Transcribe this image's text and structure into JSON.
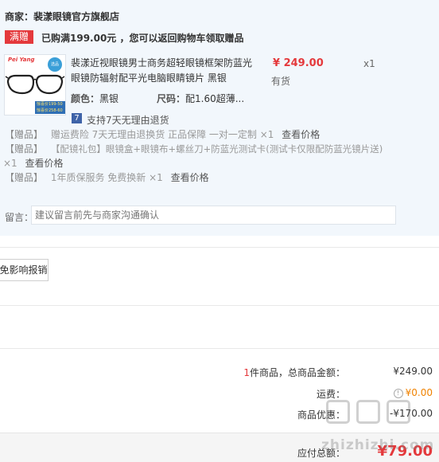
{
  "store": {
    "label": "商家：",
    "name": "裴漾眼镜官方旗舰店"
  },
  "promo": {
    "tag": "满赠",
    "text": "已购满199.00元 ，您可以返回购物车领取赠品"
  },
  "product": {
    "thumb_brand": "Pei Yang",
    "thumb_badge": "选品",
    "thumb_strip": [
      "惊喜价199-50",
      "惊喜价258-60"
    ],
    "name": "裴漾近视眼镜男士商务超轻眼镜框架防蓝光眼镜防辐射配平光电脑眼睛镜片 黑银",
    "price": "¥ 249.00",
    "qty": "x1",
    "stock": "有货",
    "color_label": "颜色：",
    "color_value": "黑银",
    "size_label": "尺码：",
    "size_value": "配1.60超薄...",
    "return_icon": "7",
    "return_text": "支持7天无理由退货"
  },
  "gifts": [
    {
      "tag": "【赠品】",
      "item": "赠运费险 7天无理由退换货 正品保障 一对一定制 ×1",
      "link": "查看价格"
    },
    {
      "tag": "【赠品】",
      "item": "【配镜礼包】眼镜盒+眼镜布+螺丝刀+防蓝光测试卡(测试卡仅限配防蓝光镜片送)",
      "item2": "×1",
      "link": "查看价格"
    },
    {
      "tag": "【赠品】",
      "item": "1年质保服务 免费换新 ×1",
      "link": "查看价格"
    }
  ],
  "message": {
    "label": "留言：",
    "placeholder": "建议留言前先与商家沟通确认"
  },
  "reimburse_button": "免影响报销",
  "summary": {
    "count": "1",
    "count_text": "件商品，总商品金额：",
    "total": "¥249.00",
    "shipping_label": "运费：",
    "shipping_value": "¥0.00",
    "discount_label": "商品优惠：",
    "discount_value": "-¥170.00"
  },
  "payment": {
    "label": "应付总额：",
    "value": "¥79.00"
  },
  "watermark": "zhizhizhi.com"
}
